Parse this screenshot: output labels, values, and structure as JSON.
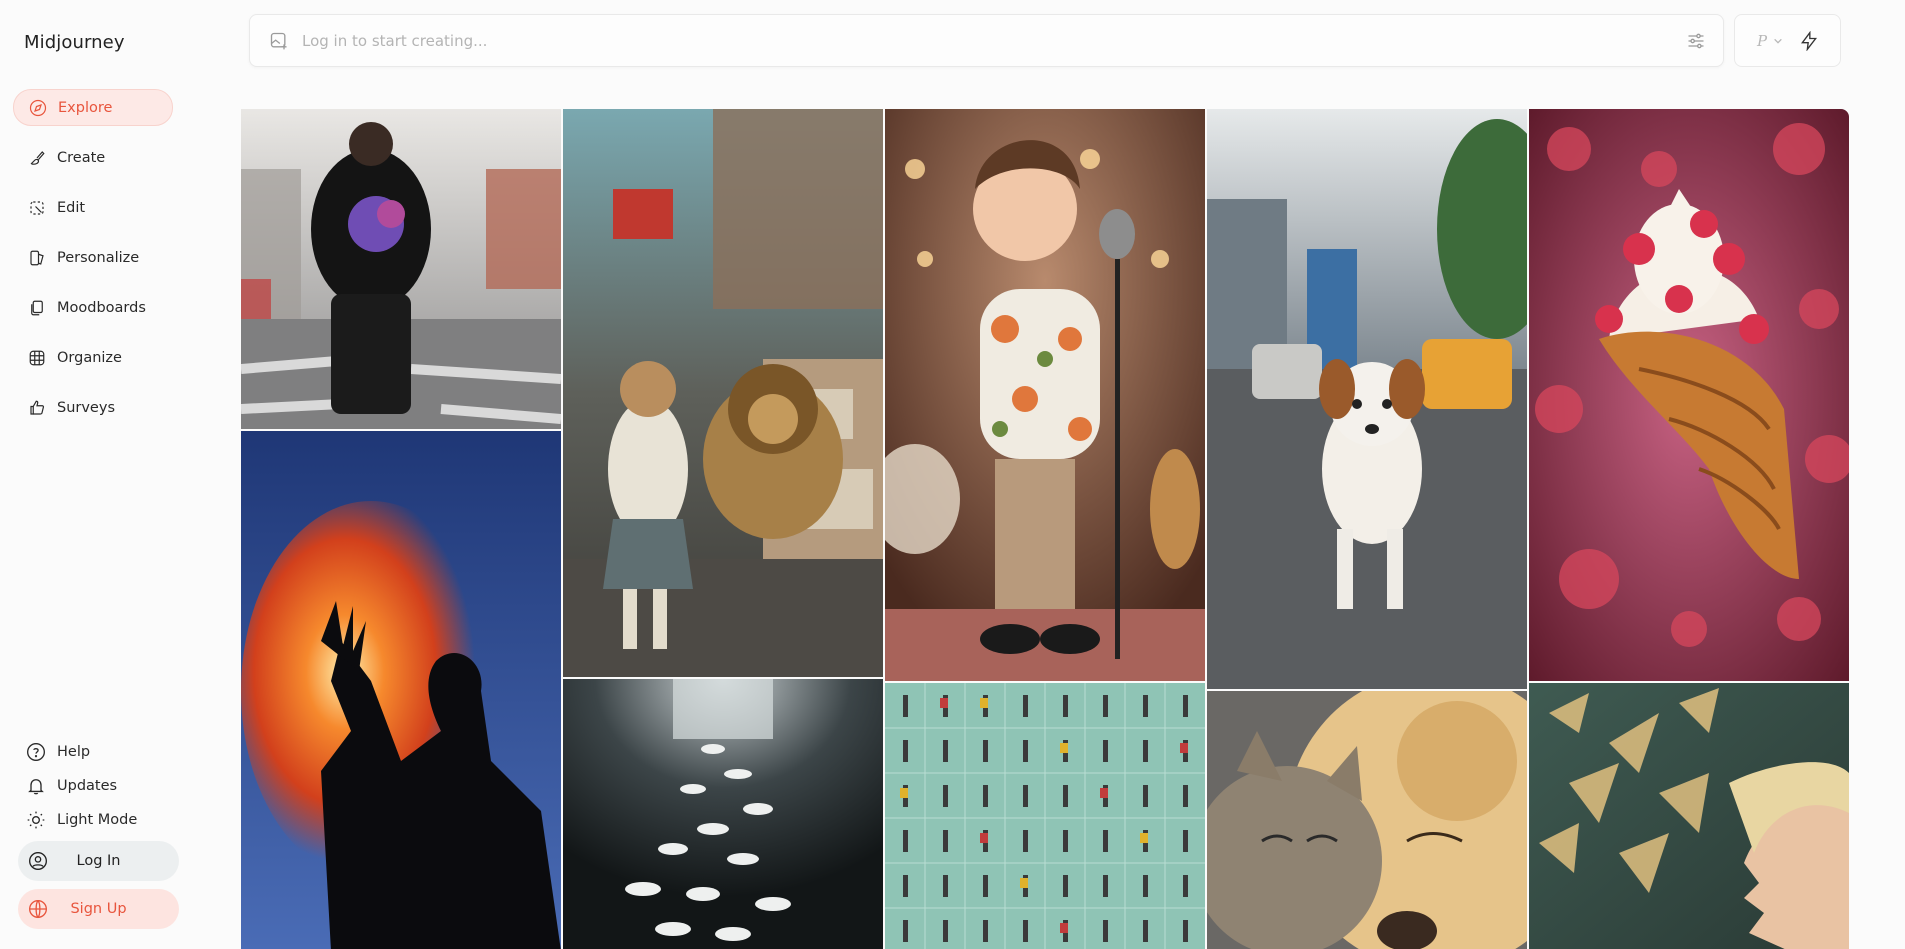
{
  "app": {
    "title": "Midjourney"
  },
  "sidebar": {
    "items": [
      {
        "label": "Explore",
        "icon": "compass-icon",
        "active": true
      },
      {
        "label": "Create",
        "icon": "brush-icon"
      },
      {
        "label": "Edit",
        "icon": "edit-icon"
      },
      {
        "label": "Personalize",
        "icon": "personalize-icon"
      },
      {
        "label": "Moodboards",
        "icon": "moodboard-icon"
      },
      {
        "label": "Organize",
        "icon": "grid-icon"
      },
      {
        "label": "Surveys",
        "icon": "thumbs-up-icon"
      }
    ],
    "bottom": [
      {
        "label": "Help",
        "icon": "help-icon"
      },
      {
        "label": "Updates",
        "icon": "bell-icon"
      },
      {
        "label": "Light Mode",
        "icon": "sun-icon"
      }
    ],
    "login_label": "Log In",
    "signup_label": "Sign Up"
  },
  "search": {
    "placeholder": "Log in to start creating..."
  },
  "speed": {
    "mode_letter": "P"
  },
  "colors": {
    "accent": "#e8553d",
    "accent_bg": "#fde9e6"
  },
  "gallery": {
    "images": [
      {
        "subject": "man in black t-shirt on crosswalk"
      },
      {
        "subject": "woman with lion on busy street"
      },
      {
        "subject": "cartoon boy singing at microphone"
      },
      {
        "subject": "puppy walking on road"
      },
      {
        "subject": "raspberry cream croissant"
      },
      {
        "subject": "silhouette with fire"
      },
      {
        "subject": "white doves in dark hall"
      },
      {
        "subject": "grid of tiny people walking"
      },
      {
        "subject": "cat and dog sleeping"
      },
      {
        "subject": "woman profile with golden shards"
      }
    ]
  }
}
